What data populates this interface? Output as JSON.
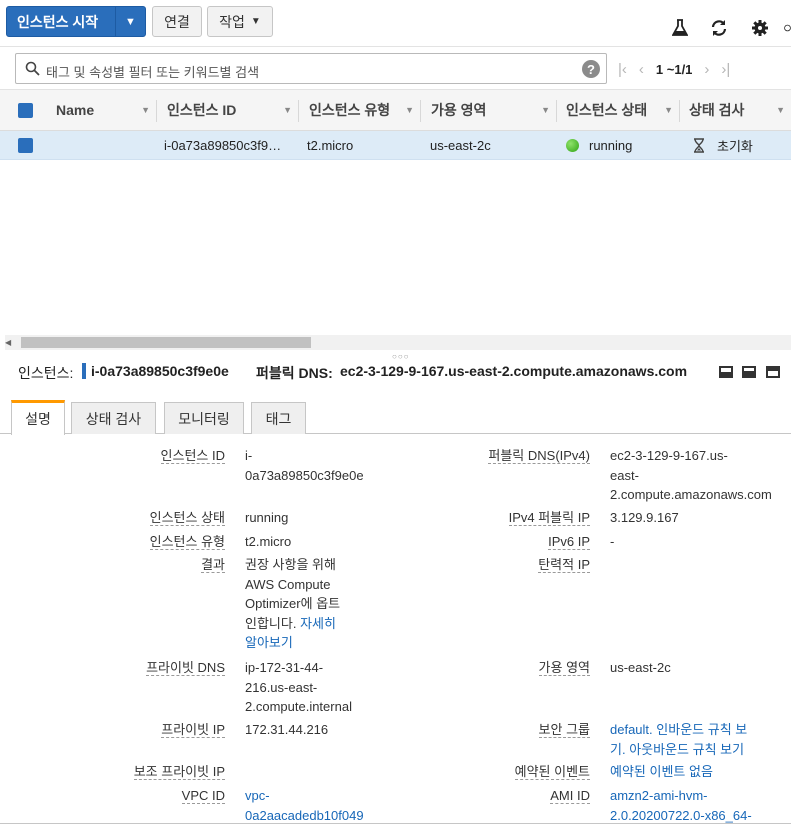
{
  "toolbar": {
    "launch_label": "인스턴스 시작",
    "connect_label": "연결",
    "actions_label": "작업",
    "icons": [
      "flask-icon",
      "refresh-icon",
      "gear-icon",
      "help-icon"
    ]
  },
  "search": {
    "placeholder": "태그 및 속성별 필터 또는 키워드별 검색",
    "help": "?",
    "page_count": "1 ~1/1"
  },
  "table": {
    "columns": [
      "Name",
      "인스턴스 ID",
      "인스턴스 유형",
      "가용 영역",
      "인스턴스 상태",
      "상태 검사"
    ],
    "rows": [
      {
        "name": "",
        "instance_id": "i-0a73a89850c3f9…",
        "instance_type": "t2.micro",
        "availability_zone": "us-east-2c",
        "state": "running",
        "status_check": "초기화"
      }
    ]
  },
  "detail": {
    "instance_label": "인스턴스:",
    "instance_id": "i-0a73a89850c3f9e0e",
    "public_dns_label": "퍼블릭 DNS:",
    "public_dns": "ec2-3-129-9-167.us-east-2.compute.amazonaws.com",
    "tabs": [
      "설명",
      "상태 검사",
      "모니터링",
      "태그"
    ],
    "left": [
      {
        "label": "인스턴스 ID",
        "lines": [
          "i-",
          "0a73a89850c3f9e0e"
        ]
      },
      {
        "label": "인스턴스 상태",
        "lines": [
          "running"
        ]
      },
      {
        "label": "인스턴스 유형",
        "lines": [
          "t2.micro"
        ]
      },
      {
        "label": "결과",
        "lines": [
          "권장 사항을 위해",
          "AWS Compute",
          "Optimizer에 옵트",
          "인합니다.",
          "자세히",
          "알아보기"
        ]
      },
      {
        "label": "프라이빗 DNS",
        "lines": [
          "ip-172-31-44-",
          "216.us-east-",
          "2.compute.internal"
        ]
      },
      {
        "label": "프라이빗 IP",
        "lines": [
          "172.31.44.216"
        ]
      },
      {
        "label": "보조 프라이빗 IP",
        "lines": []
      },
      {
        "label": "VPC ID",
        "lines": [
          "vpc-",
          "0a2aacadedb10f049"
        ]
      }
    ],
    "right": [
      {
        "label": "퍼블릭 DNS(IPv4)",
        "lines": [
          "ec2-3-129-9-167.us-",
          "east-",
          "2.compute.amazonaws.com"
        ]
      },
      {
        "label": "IPv4 퍼블릭 IP",
        "lines": [
          "3.129.9.167"
        ]
      },
      {
        "label": "IPv6 IP",
        "lines": [
          "-"
        ]
      },
      {
        "label": "탄력적 IP",
        "lines": []
      },
      {
        "label": "가용 영역",
        "lines": [
          "us-east-2c"
        ]
      },
      {
        "label": "보안 그룹",
        "lines": [
          "default.",
          "인바운드 규칙 보",
          "기.",
          "아웃바운드 규칙 보기"
        ]
      },
      {
        "label": "예약된 이벤트",
        "lines": [
          "예약된 이벤트 없음"
        ]
      },
      {
        "label": "AMI ID",
        "lines": [
          "amzn2-ami-hvm-",
          "2.0.20200722.0-x86_64-"
        ]
      }
    ]
  }
}
